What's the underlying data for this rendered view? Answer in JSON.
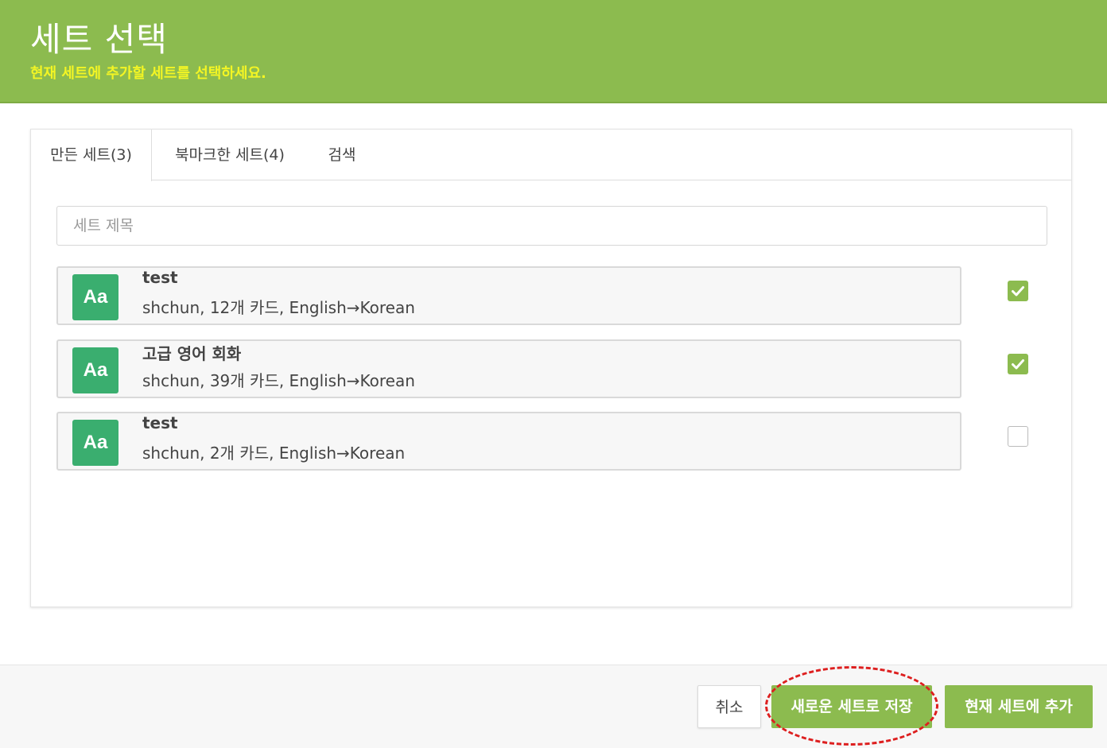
{
  "header": {
    "title": "세트 선택",
    "subtitle": "현재 세트에 추가할 세트를 선택하세요."
  },
  "tabs": [
    {
      "label": "만든 세트(3)",
      "active": true
    },
    {
      "label": "북마크한 세트(4)",
      "active": false
    },
    {
      "label": "검색",
      "active": false
    }
  ],
  "search": {
    "placeholder": "세트 제목",
    "value": ""
  },
  "sets": [
    {
      "thumb": "Aa",
      "name": "test",
      "meta": "shchun, 12개 카드, English→Korean",
      "checked": true
    },
    {
      "thumb": "Aa",
      "name": "고급 영어 회화",
      "meta": "shchun, 39개 카드, English→Korean",
      "checked": true
    },
    {
      "thumb": "Aa",
      "name": "test",
      "meta": "shchun, 2개 카드, English→Korean",
      "checked": false
    }
  ],
  "footer": {
    "cancel_label": "취소",
    "save_new_label": "새로운 세트로 저장",
    "add_current_label": "현재 세트에 추가"
  },
  "colors": {
    "header": "#8cbb4f",
    "subtitle": "#f3f524",
    "thumb": "#3aae6f",
    "highlight": "#dd1f1f"
  }
}
